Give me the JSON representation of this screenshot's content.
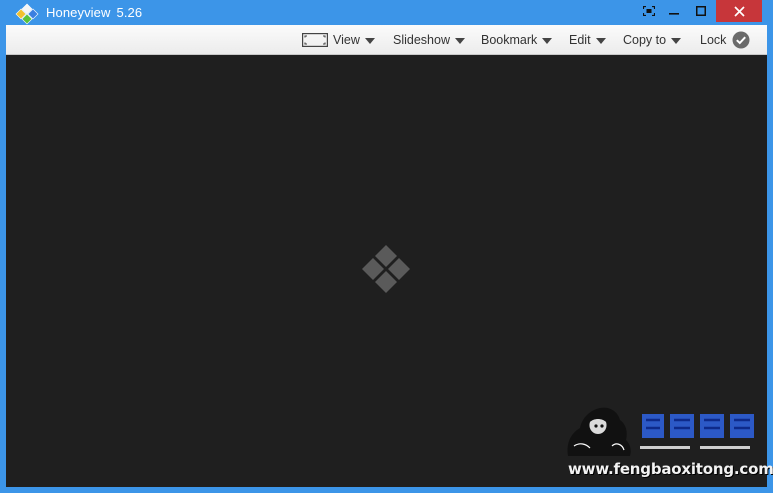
{
  "window": {
    "app_name": "Honeyview",
    "version": "5.26"
  },
  "toolbar": {
    "view_label": "View",
    "slideshow_label": "Slideshow",
    "bookmark_label": "Bookmark",
    "edit_label": "Edit",
    "copy_to_label": "Copy to",
    "lock_label": "Lock"
  },
  "watermark": {
    "url": "www.fengbaoxitong.com"
  },
  "colors": {
    "titlebar": "#3c95e8",
    "close_button": "#c7363a",
    "viewer_background": "#1f1f1f",
    "toolbar_background": "#f4f4f4",
    "logo_gray": "#5a5a5a"
  },
  "icons": {
    "app": "honeyview-logo-icon",
    "fullscreen": "fullscreen-icon",
    "minimize": "minimize-icon",
    "maximize": "maximize-icon",
    "close": "close-icon",
    "fit": "fit-to-window-icon",
    "lock_status": "check-circle-icon",
    "center": "honeyview-placeholder-logo-icon"
  }
}
